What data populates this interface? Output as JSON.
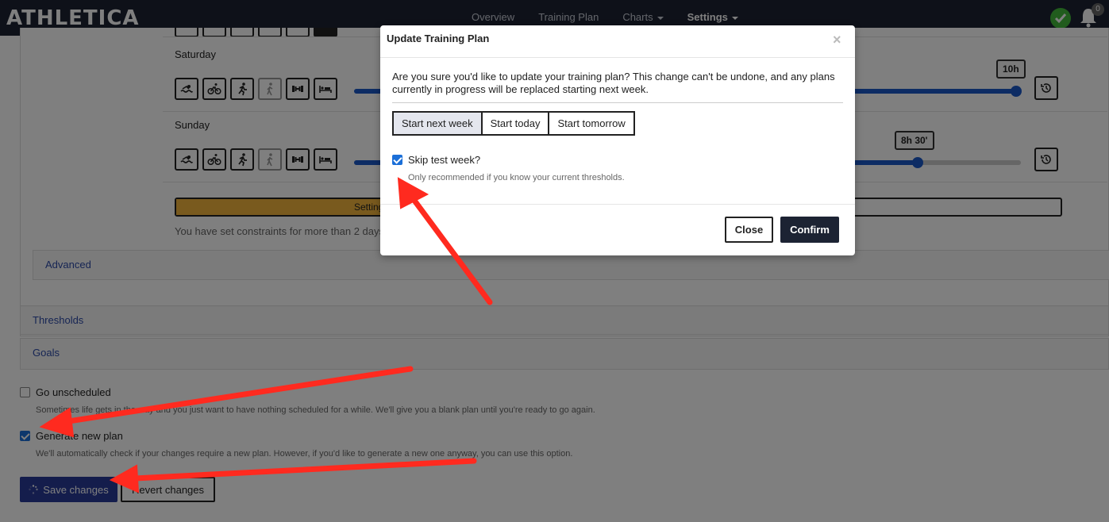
{
  "app": {
    "logo_text": "ATHLETICA",
    "nav": [
      {
        "label": "Overview"
      },
      {
        "label": "Training Plan"
      },
      {
        "label": "Charts"
      },
      {
        "label": "Settings"
      }
    ],
    "notifications_count": "0",
    "colors": {
      "navbar": "#1c2333",
      "accent_blue": "#1b58c9",
      "status_green": "#42b83a"
    }
  },
  "schedule": {
    "days": [
      {
        "label": "Saturday",
        "max_duration": "10h",
        "fill_fraction": 1.0
      },
      {
        "label": "Sunday",
        "max_duration": "8h 30'",
        "fill_fraction": 0.85
      }
    ],
    "activity_icons": [
      "swim-icon",
      "bike-icon",
      "run-icon",
      "walk-icon",
      "strength-icon",
      "rest-icon"
    ],
    "warning_label": "Setting",
    "constraint_hint": "You have set constraints for more than 2 days"
  },
  "sections": {
    "advanced": "Advanced",
    "thresholds": "Thresholds",
    "goals": "Goals"
  },
  "options": {
    "go_unscheduled": {
      "label": "Go unscheduled",
      "checked": false,
      "hint": "Sometimes life gets in the way and you just want to have nothing scheduled for a while. We'll give you a blank plan until you're ready to go again."
    },
    "generate_new_plan": {
      "label": "Generate new plan",
      "checked": true,
      "hint": "We'll automatically check if your changes require a new plan. However, if you'd like to generate a new one anyway, you can use this option."
    }
  },
  "actions": {
    "save": "Save changes",
    "revert": "Revert changes"
  },
  "modal": {
    "title": "Update Training Plan",
    "close_glyph": "×",
    "body": "Are you sure you'd like to update your training plan? This change can't be undone, and any plans currently in progress will be replaced starting next week.",
    "start_options": [
      {
        "label": "Start next week",
        "selected": true
      },
      {
        "label": "Start today",
        "selected": false
      },
      {
        "label": "Start tomorrow",
        "selected": false
      }
    ],
    "skip_test_week": {
      "label": "Skip test week?",
      "checked": true,
      "hint": "Only recommended if you know your current thresholds."
    },
    "close_label": "Close",
    "confirm_label": "Confirm"
  }
}
